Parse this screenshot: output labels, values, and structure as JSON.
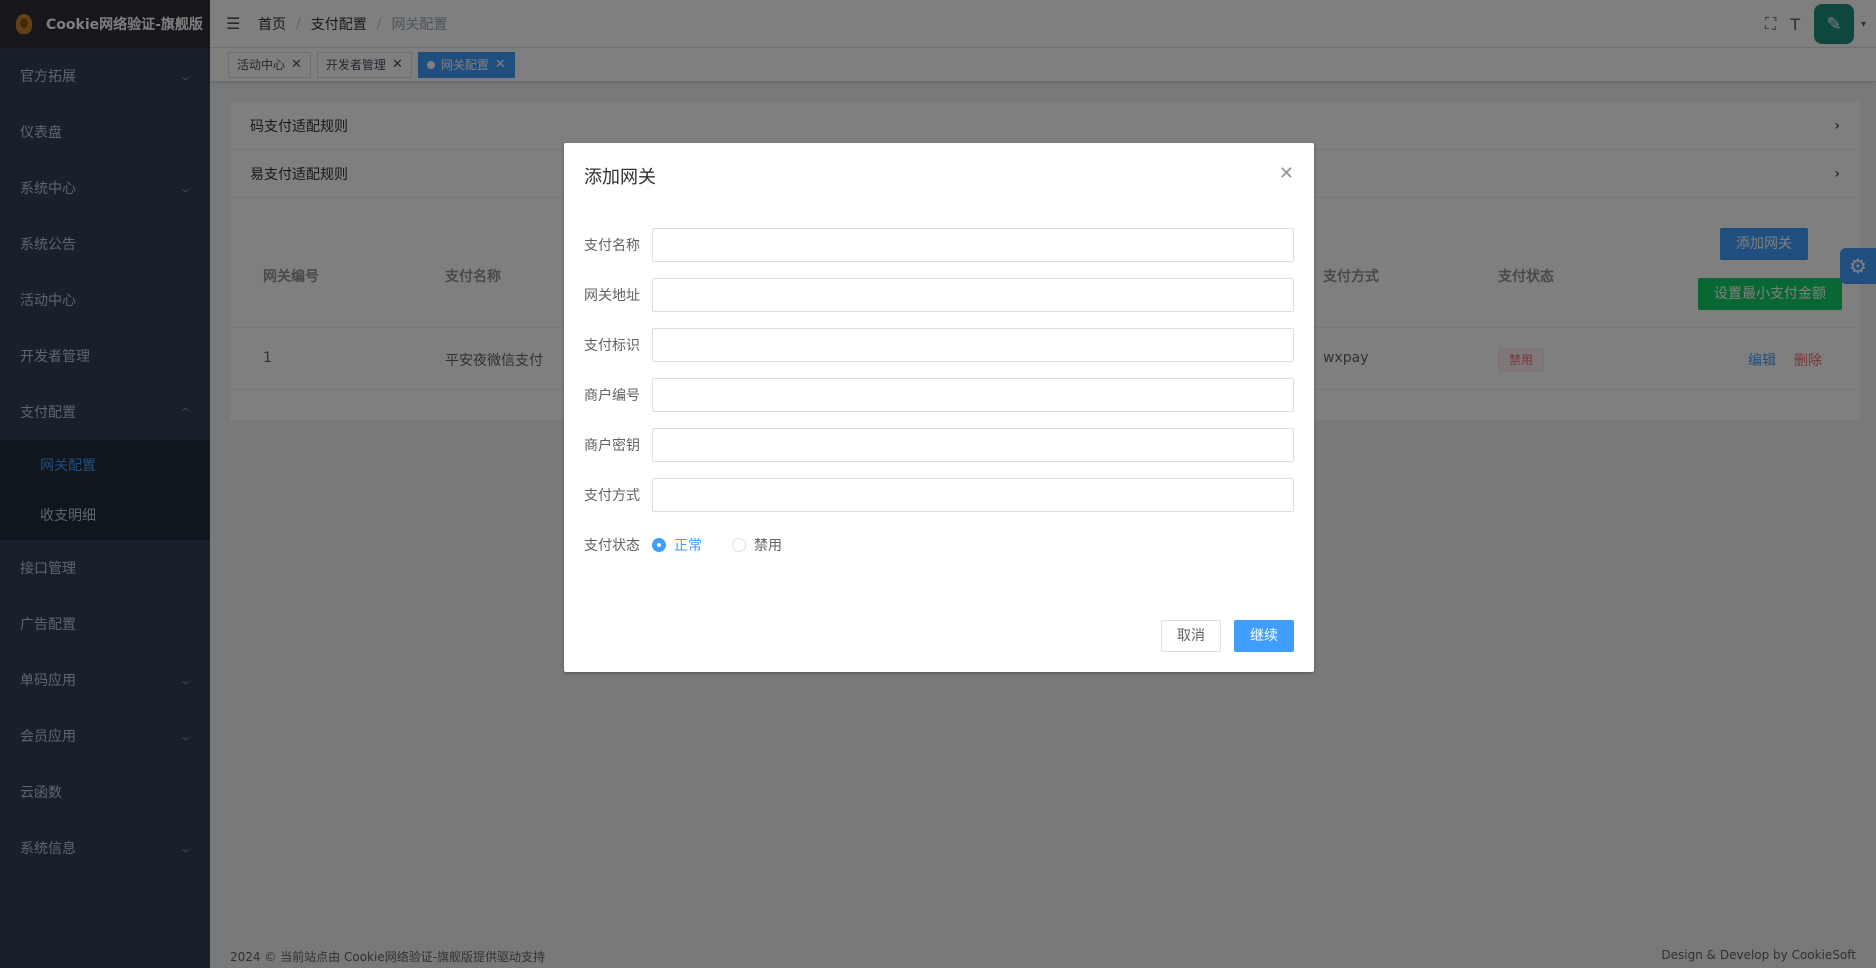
{
  "app": {
    "title": "Cookie网络验证-旗舰版"
  },
  "sidebar": {
    "items": [
      {
        "label": "官方拓展",
        "expandable": true
      },
      {
        "label": "仪表盘",
        "expandable": false
      },
      {
        "label": "系统中心",
        "expandable": true
      },
      {
        "label": "系统公告",
        "expandable": false
      },
      {
        "label": "活动中心",
        "expandable": false
      },
      {
        "label": "开发者管理",
        "expandable": false
      },
      {
        "label": "支付配置",
        "expandable": true,
        "expanded": true
      },
      {
        "label": "接口管理",
        "expandable": false
      },
      {
        "label": "广告配置",
        "expandable": false
      },
      {
        "label": "单码应用",
        "expandable": true
      },
      {
        "label": "会员应用",
        "expandable": true
      },
      {
        "label": "云函数",
        "expandable": false
      },
      {
        "label": "系统信息",
        "expandable": true
      }
    ],
    "submenu": [
      {
        "label": "网关配置",
        "active": true
      },
      {
        "label": "收支明细",
        "active": false
      }
    ]
  },
  "header": {
    "breadcrumb": [
      "首页",
      "支付配置",
      "网关配置"
    ]
  },
  "tags": [
    {
      "label": "活动中心",
      "active": false
    },
    {
      "label": "开发者管理",
      "active": false
    },
    {
      "label": "网关配置",
      "active": true
    }
  ],
  "main": {
    "collapse": [
      "码支付适配规则",
      "易支付适配规则"
    ],
    "buttons": {
      "add": "添加网关",
      "min_amount": "设置最小支付金额"
    },
    "table": {
      "headers": [
        "网关编号",
        "支付名称",
        "支付方式",
        "支付状态"
      ],
      "rows": [
        {
          "id": "1",
          "name": "平安夜微信支付",
          "method": "wxpay",
          "status": "禁用",
          "edit": "编辑",
          "delete": "删除"
        }
      ]
    }
  },
  "footer": {
    "left": "2024 © 当前站点由 Cookie网络验证-旗舰版提供驱动支持",
    "right": "Design & Develop by CookieSoft"
  },
  "modal": {
    "title": "添加网关",
    "fields": [
      {
        "label": "支付名称",
        "value": ""
      },
      {
        "label": "网关地址",
        "value": ""
      },
      {
        "label": "支付标识",
        "value": ""
      },
      {
        "label": "商户编号",
        "value": ""
      },
      {
        "label": "商户密钥",
        "value": ""
      },
      {
        "label": "支付方式",
        "value": ""
      }
    ],
    "status": {
      "label": "支付状态",
      "options": [
        "正常",
        "禁用"
      ],
      "selected": "正常"
    },
    "cancel": "取消",
    "confirm": "继续"
  },
  "colors": {
    "primary": "#409eff",
    "success": "#13ce66",
    "danger": "#f56c6c",
    "sidebar": "#304156"
  }
}
